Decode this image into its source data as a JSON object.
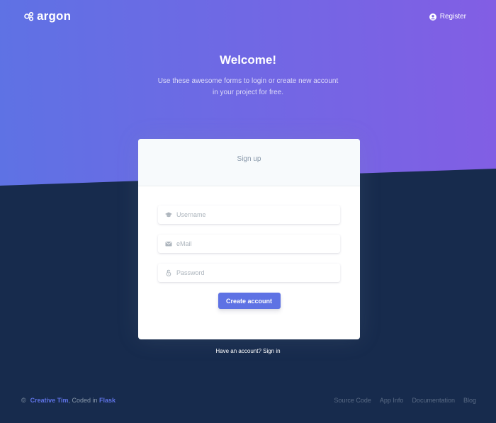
{
  "brand": {
    "name": "argon",
    "icon": "argon-logo-icon"
  },
  "nav": {
    "register_label": "Register",
    "register_icon": "user-circle-icon"
  },
  "hero": {
    "title": "Welcome!",
    "subtitle": "Use these awesome forms to login or create new account in your project for free."
  },
  "form": {
    "header": "Sign up",
    "username_placeholder": "Username",
    "username_icon": "graduation-cap-icon",
    "email_placeholder": "eMail",
    "email_icon": "envelope-icon",
    "password_placeholder": "Password",
    "password_icon": "lock-icon",
    "submit_label": "Create account"
  },
  "signin": {
    "text": "Have an account? Sign in"
  },
  "footer": {
    "copyright_symbol": "©",
    "author": "Creative Tim",
    "coded_in": ", Coded in ",
    "framework": "Flask",
    "links": [
      "Source Code",
      "App Info",
      "Documentation",
      "Blog"
    ]
  },
  "colors": {
    "primary": "#5e72e4",
    "gradient_end": "#825ee4",
    "dark_background": "#172b4d",
    "muted": "#8898aa"
  }
}
